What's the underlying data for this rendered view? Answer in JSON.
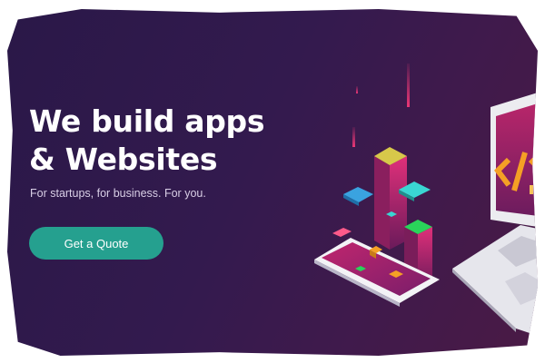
{
  "hero": {
    "title_line1": "We build apps",
    "title_line2": "& Websites",
    "subtitle": "For startups, for business. For you.",
    "cta_label": "Get a Quote"
  },
  "colors": {
    "background_dark": "#2a1848",
    "background_warm": "#4a1a45",
    "accent_teal": "#25a08f",
    "heading_text": "#ffffff",
    "subtitle_text": "#d9cfe6",
    "tower_magenta": "#c0266e",
    "cube_blue": "#3aa3e0",
    "cube_cyan": "#3ad6d2",
    "cube_green": "#2ad45a",
    "cube_orange": "#f5a025",
    "device_white": "#f3f3f6"
  },
  "illustration": {
    "icons": [
      "smartphone-icon",
      "laptop-icon",
      "code-brackets-icon",
      "isometric-tower-icon",
      "floating-cube-icon"
    ],
    "laptop_screen_glyph": "</>"
  }
}
